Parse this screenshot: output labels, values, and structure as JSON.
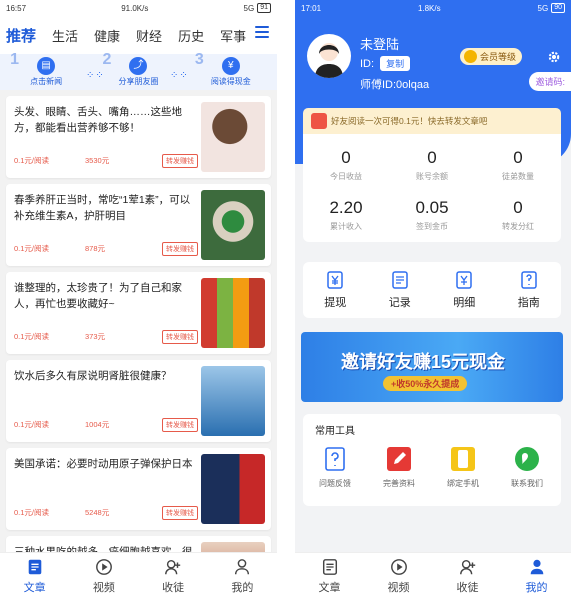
{
  "left": {
    "status": {
      "time": "16:57",
      "speed": "91.0K/s",
      "network": "5G",
      "battery": "91"
    },
    "tabs": [
      "推荐",
      "生活",
      "健康",
      "财经",
      "历史",
      "军事"
    ],
    "promo": [
      {
        "num": "1",
        "label": "点击新闻",
        "icon": "newspaper-icon"
      },
      {
        "num": "2",
        "label": "分享朋友圈",
        "icon": "share-icon"
      },
      {
        "num": "3",
        "label": "阅读得现金",
        "icon": "cash-icon"
      }
    ],
    "articles": [
      {
        "title": "头发、眼睛、舌头、嘴角……这些地方，都能看出营养够不够！",
        "reads": "0.1元/阅读",
        "count": "3530元",
        "share": "转发赚钱"
      },
      {
        "title": "春季养肝正当时，常吃“1荤1素”，可以补充维生素A，护肝明目",
        "reads": "0.1元/阅读",
        "count": "878元",
        "share": "转发赚钱"
      },
      {
        "title": "谁整理的，太珍贵了！为了自己和家人，再忙也要收藏好~",
        "reads": "0.1元/阅读",
        "count": "373元",
        "share": "转发赚钱"
      },
      {
        "title": "饮水后多久有尿说明肾脏很健康？",
        "reads": "0.1元/阅读",
        "count": "1004元",
        "share": "转发赚钱"
      },
      {
        "title": "美国承诺：必要时动用原子弹保护日本",
        "reads": "0.1元/阅读",
        "count": "5248元",
        "share": "转发赚钱"
      },
      {
        "title": "三种水果吃的越多，癌细胞越喜欢，很",
        "reads": "",
        "count": "",
        "share": ""
      }
    ],
    "tabbar": [
      {
        "label": "文章",
        "icon": "article-icon",
        "active": true
      },
      {
        "label": "视频",
        "icon": "play-icon",
        "active": false
      },
      {
        "label": "收徒",
        "icon": "add-user-icon",
        "active": false
      },
      {
        "label": "我的",
        "icon": "user-icon",
        "active": false
      }
    ]
  },
  "right": {
    "status": {
      "time": "17:01",
      "speed": "1.8K/s",
      "network": "5G",
      "battery": "90"
    },
    "profile": {
      "name": "未登陆",
      "id_label": "ID:",
      "copy": "复制",
      "master": "师傅ID:0olqaa",
      "member": "会员等级",
      "invite": "邀请码:"
    },
    "notice": "好友阅读一次可得0.1元！快去转发文章吧",
    "stats": [
      {
        "value": "0",
        "label": "今日收益"
      },
      {
        "value": "0",
        "label": "账号余额"
      },
      {
        "value": "0",
        "label": "徒弟数量"
      },
      {
        "value": "2.20",
        "label": "累计收入"
      },
      {
        "value": "0.05",
        "label": "签到金币"
      },
      {
        "value": "0",
        "label": "转发分红"
      }
    ],
    "actions": [
      {
        "label": "提现",
        "icon": "withdraw-icon"
      },
      {
        "label": "记录",
        "icon": "record-icon"
      },
      {
        "label": "明细",
        "icon": "detail-icon"
      },
      {
        "label": "指南",
        "icon": "guide-icon"
      }
    ],
    "banner": {
      "title": "邀请好友赚15元现金",
      "sub": "+收50%永久提成"
    },
    "tools_title": "常用工具",
    "tools": [
      {
        "label": "问题反馈",
        "icon": "feedback-icon",
        "color": "#2f6ff0"
      },
      {
        "label": "完善资料",
        "icon": "edit-icon",
        "color": "#e53935"
      },
      {
        "label": "绑定手机",
        "icon": "phone-icon",
        "color": "#f5c518"
      },
      {
        "label": "联系我们",
        "icon": "wechat-icon",
        "color": "#2cb24a"
      }
    ],
    "tabbar": [
      {
        "label": "文章",
        "icon": "article-icon",
        "active": false
      },
      {
        "label": "视频",
        "icon": "play-icon",
        "active": false
      },
      {
        "label": "收徒",
        "icon": "add-user-icon",
        "active": false
      },
      {
        "label": "我的",
        "icon": "user-icon",
        "active": true
      }
    ]
  }
}
